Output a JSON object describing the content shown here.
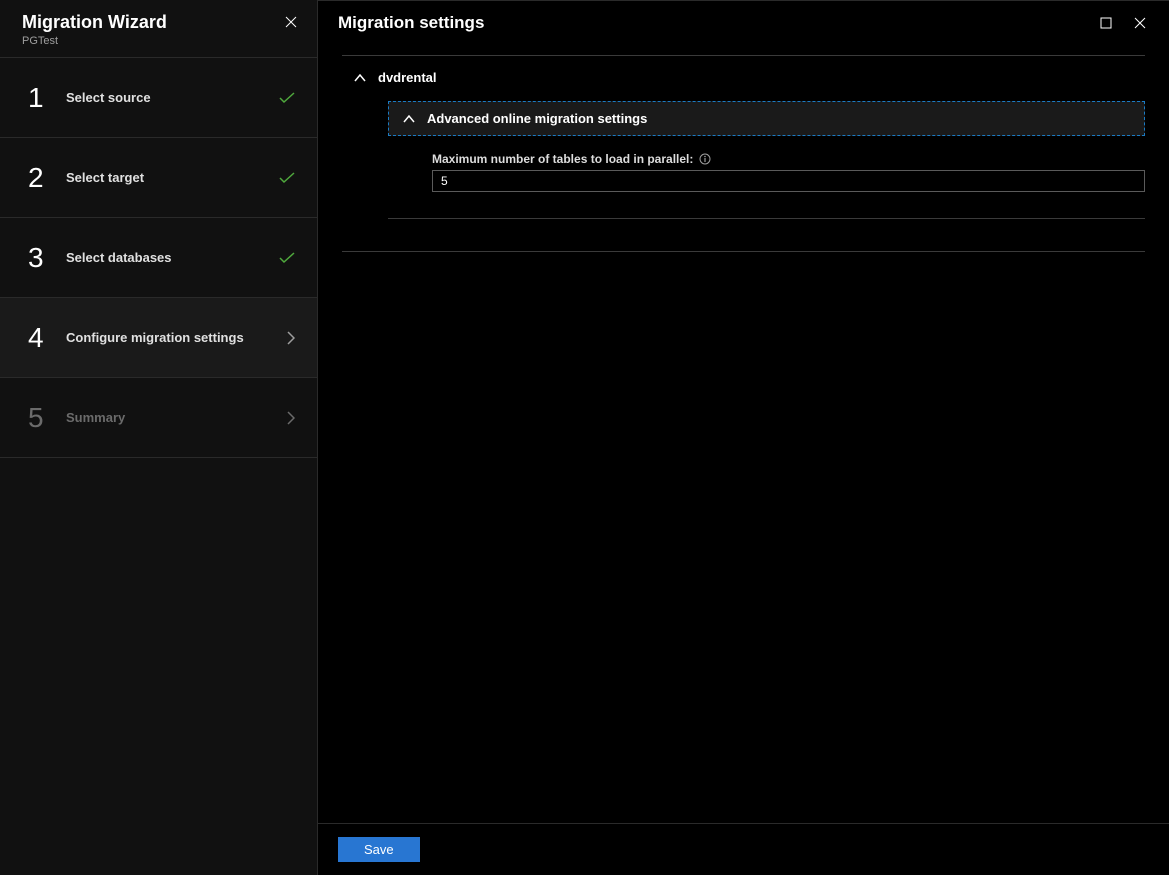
{
  "sidebar": {
    "title": "Migration Wizard",
    "subtitle": "PGTest",
    "steps": [
      {
        "num": "1",
        "label": "Select source",
        "status": "done"
      },
      {
        "num": "2",
        "label": "Select target",
        "status": "done"
      },
      {
        "num": "3",
        "label": "Select databases",
        "status": "done"
      },
      {
        "num": "4",
        "label": "Configure migration settings",
        "status": "active"
      },
      {
        "num": "5",
        "label": "Summary",
        "status": "pending"
      }
    ]
  },
  "main": {
    "title": "Migration settings",
    "database_section": {
      "name": "dvdrental"
    },
    "advanced_section": {
      "label": "Advanced online migration settings"
    },
    "field": {
      "label": "Maximum number of tables to load in parallel:",
      "value": "5"
    },
    "save_label": "Save"
  }
}
